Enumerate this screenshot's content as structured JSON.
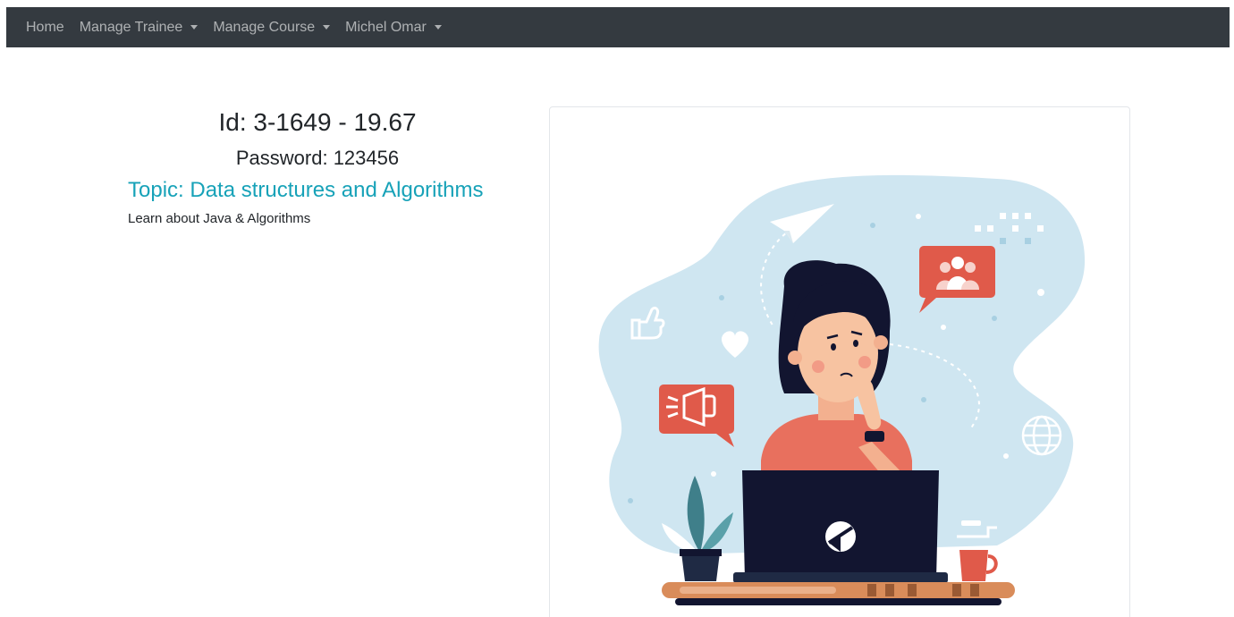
{
  "navbar": {
    "items": [
      {
        "label": "Home",
        "dropdown": false
      },
      {
        "label": "Manage Trainee",
        "dropdown": true
      },
      {
        "label": "Manage Course",
        "dropdown": true
      },
      {
        "label": "Michel Omar",
        "dropdown": true
      }
    ]
  },
  "course": {
    "id_line": "Id: 3-1649 - 19.67",
    "password_line": "Password: 123456",
    "topic_line": "Topic: Data structures and Algorithms",
    "description": "Learn about Java & Algorithms"
  },
  "colors": {
    "navbar_bg": "#343a40",
    "topic": "#17a2b8",
    "blob": "#cfe6f1",
    "accent_red": "#e05a4a"
  },
  "icons": [
    "caret-down-icon",
    "paper-plane-icon",
    "group-icon",
    "thumbs-up-icon",
    "heart-icon",
    "megaphone-icon",
    "globe-icon",
    "coffee-cup-icon",
    "plant-icon",
    "laptop-icon"
  ]
}
